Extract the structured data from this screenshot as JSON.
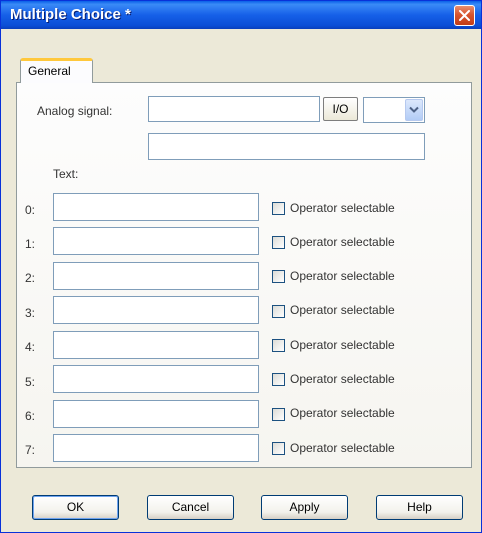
{
  "window": {
    "title": "Multiple Choice *"
  },
  "tabs": [
    {
      "label": "General"
    }
  ],
  "general": {
    "analog_signal_label": "Analog signal:",
    "analog_signal_value": "",
    "io_button_label": "I/O",
    "io_select_value": "",
    "signal_description_value": "",
    "text_heading": "Text:",
    "choices": [
      {
        "index": "0:",
        "text": "",
        "checkbox_label": "Operator selectable",
        "checked": false
      },
      {
        "index": "1:",
        "text": "",
        "checkbox_label": "Operator selectable",
        "checked": false
      },
      {
        "index": "2:",
        "text": "",
        "checkbox_label": "Operator selectable",
        "checked": false
      },
      {
        "index": "3:",
        "text": "",
        "checkbox_label": "Operator selectable",
        "checked": false
      },
      {
        "index": "4:",
        "text": "",
        "checkbox_label": "Operator selectable",
        "checked": false
      },
      {
        "index": "5:",
        "text": "",
        "checkbox_label": "Operator selectable",
        "checked": false
      },
      {
        "index": "6:",
        "text": "",
        "checkbox_label": "Operator selectable",
        "checked": false
      },
      {
        "index": "7:",
        "text": "",
        "checkbox_label": "Operator selectable",
        "checked": false
      }
    ]
  },
  "buttons": {
    "ok": "OK",
    "cancel": "Cancel",
    "apply": "Apply",
    "help": "Help"
  },
  "colors": {
    "titlebar": "#0b4ed6",
    "close_button": "#d8552f",
    "tab_highlight": "#ffc83c",
    "dialog_background": "#ece9d8"
  }
}
